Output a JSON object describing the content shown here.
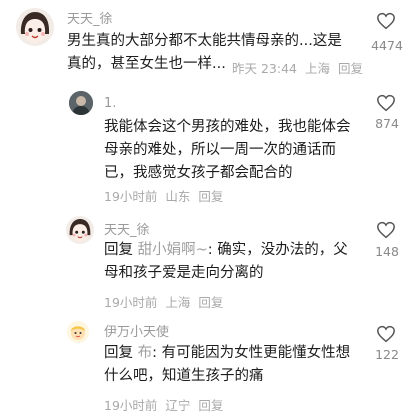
{
  "comments": [
    {
      "username": "天天_徐",
      "lines": [
        "男生真的大部分都不太能共情母亲的...这是",
        "真的，甚至女生也一样..."
      ],
      "time": "昨天 23:44",
      "location": "上海",
      "reply_label": "回复",
      "likes": "4474"
    },
    {
      "username": "1.",
      "lines": [
        "我能体会这个男孩的难处，我也能体会",
        "母亲的难处，所以一周一次的通话而",
        "已，我感觉女孩子都会配合的"
      ],
      "time": "19小时前",
      "location": "山东",
      "reply_label": "回复",
      "likes": "874"
    },
    {
      "username": "天天_徐",
      "reply_prefix": "回复",
      "reply_to": "甜小娟啊~",
      "first_line_rest": ": 确实，没办法的，父",
      "lines_after": [
        "母和孩子爱是走向分离的"
      ],
      "time": "19小时前",
      "location": "上海",
      "reply_label": "回复",
      "likes": "148"
    },
    {
      "username": "伊万小天使",
      "reply_prefix": "回复",
      "reply_to": "布",
      "first_line_rest": ": 有可能因为女性更能懂女性想",
      "lines_after": [
        "什么吧，知道生孩子的痛"
      ],
      "time": "19小时前",
      "location": "辽宁",
      "reply_label": "回复",
      "likes": "122"
    }
  ],
  "icons": {
    "like": "heart-outline-icon"
  },
  "colors": {
    "text": "#1c1c1c",
    "muted": "#a9a9a9"
  }
}
